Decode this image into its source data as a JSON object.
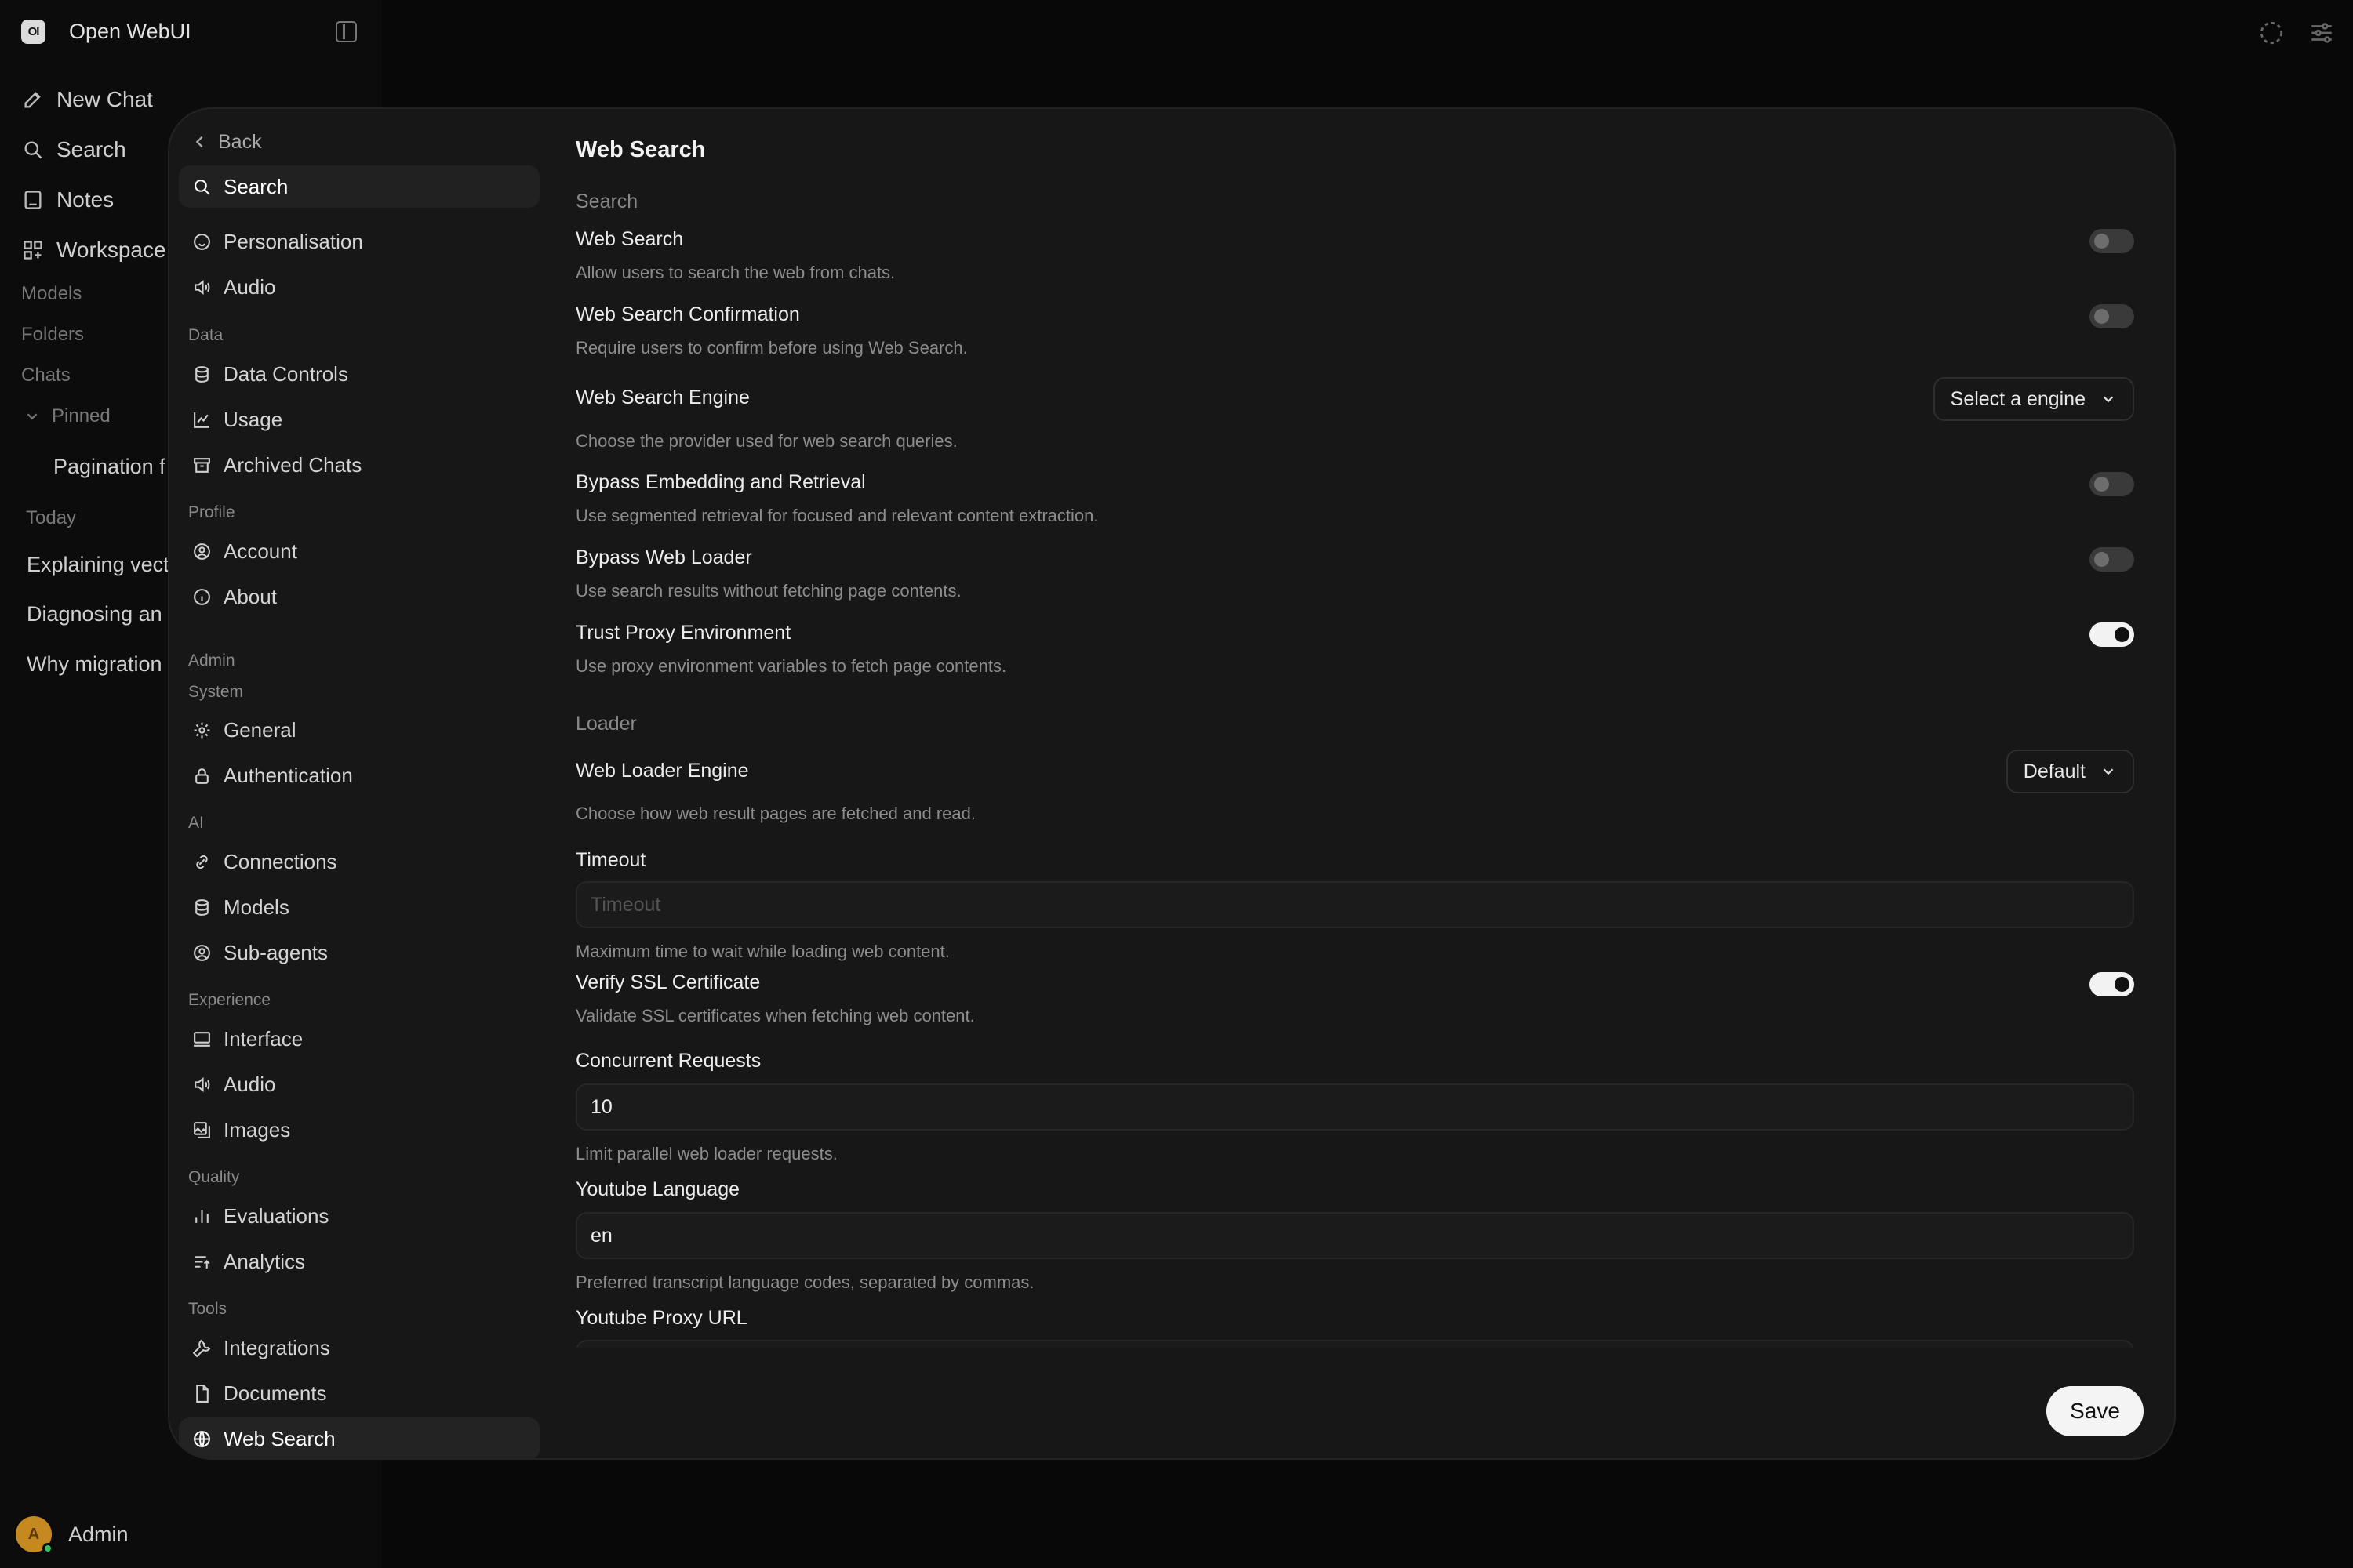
{
  "app": {
    "brand_logo": "OI",
    "brand_name": "Open WebUI",
    "nav": [
      {
        "label": "New Chat",
        "icon": "pencil-icon"
      },
      {
        "label": "Search",
        "icon": "search-icon"
      },
      {
        "label": "Notes",
        "icon": "notes-icon"
      },
      {
        "label": "Workspace",
        "icon": "grid-icon"
      }
    ],
    "sections": {
      "models": "Models",
      "folders": "Folders",
      "chats": "Chats",
      "pinned": "Pinned",
      "today": "Today"
    },
    "pinned_chats": [
      "Pagination f"
    ],
    "today_chats": [
      "Explaining vect",
      "Diagnosing an",
      "Why migration"
    ],
    "user": {
      "initial": "A",
      "name": "Admin",
      "status_color": "#33c15c"
    }
  },
  "settings": {
    "back_label": "Back",
    "search_label": "Search",
    "groups": {
      "top": [
        {
          "label": "Personalisation",
          "icon": "smile-icon"
        },
        {
          "label": "Audio",
          "icon": "speaker-icon"
        }
      ],
      "data_heading": "Data",
      "data": [
        {
          "label": "Data Controls",
          "icon": "database-icon"
        },
        {
          "label": "Usage",
          "icon": "chart-line-icon"
        },
        {
          "label": "Archived Chats",
          "icon": "archive-icon"
        }
      ],
      "profile_heading": "Profile",
      "profile": [
        {
          "label": "Account",
          "icon": "user-circle-icon"
        },
        {
          "label": "About",
          "icon": "info-icon"
        }
      ],
      "admin_heading": "Admin",
      "system_heading": "System",
      "system": [
        {
          "label": "General",
          "icon": "gear-icon"
        },
        {
          "label": "Authentication",
          "icon": "lock-icon"
        }
      ],
      "ai_heading": "AI",
      "ai": [
        {
          "label": "Connections",
          "icon": "link-icon"
        },
        {
          "label": "Models",
          "icon": "stack-icon"
        },
        {
          "label": "Sub-agents",
          "icon": "user-circle-icon"
        }
      ],
      "experience_heading": "Experience",
      "experience": [
        {
          "label": "Interface",
          "icon": "monitor-icon"
        },
        {
          "label": "Audio",
          "icon": "speaker-icon"
        },
        {
          "label": "Images",
          "icon": "images-icon"
        }
      ],
      "quality_heading": "Quality",
      "quality": [
        {
          "label": "Evaluations",
          "icon": "bar-chart-icon"
        },
        {
          "label": "Analytics",
          "icon": "analytics-icon"
        }
      ],
      "tools_heading": "Tools",
      "tools": [
        {
          "label": "Integrations",
          "icon": "wrench-icon"
        },
        {
          "label": "Documents",
          "icon": "document-icon"
        },
        {
          "label": "Web Search",
          "icon": "globe-icon"
        }
      ]
    }
  },
  "page": {
    "title": "Web Search",
    "search_section": "Search",
    "web_search": {
      "title": "Web Search",
      "desc": "Allow users to search the web from chats.",
      "enabled": false
    },
    "confirmation": {
      "title": "Web Search Confirmation",
      "desc": "Require users to confirm before using Web Search.",
      "enabled": false
    },
    "engine": {
      "title": "Web Search Engine",
      "desc": "Choose the provider used for web search queries.",
      "value": "Select a engine"
    },
    "bypass_embedding": {
      "title": "Bypass Embedding and Retrieval",
      "desc": "Use segmented retrieval for focused and relevant content extraction.",
      "enabled": false
    },
    "bypass_loader": {
      "title": "Bypass Web Loader",
      "desc": "Use search results without fetching page contents.",
      "enabled": false
    },
    "trust_proxy": {
      "title": "Trust Proxy Environment",
      "desc": "Use proxy environment variables to fetch page contents.",
      "enabled": true
    },
    "loader_section": "Loader",
    "loader_engine": {
      "title": "Web Loader Engine",
      "desc": "Choose how web result pages are fetched and read.",
      "value": "Default"
    },
    "timeout": {
      "title": "Timeout",
      "placeholder": "Timeout",
      "desc": "Maximum time to wait while loading web content."
    },
    "verify_ssl": {
      "title": "Verify SSL Certificate",
      "desc": "Validate SSL certificates when fetching web content.",
      "enabled": true
    },
    "concurrent": {
      "title": "Concurrent Requests",
      "value": "10",
      "desc": "Limit parallel web loader requests."
    },
    "youtube_language": {
      "title": "Youtube Language",
      "value": "en",
      "desc": "Preferred transcript language codes, separated by commas."
    },
    "youtube_proxy": {
      "title": "Youtube Proxy URL"
    },
    "save_label": "Save"
  }
}
